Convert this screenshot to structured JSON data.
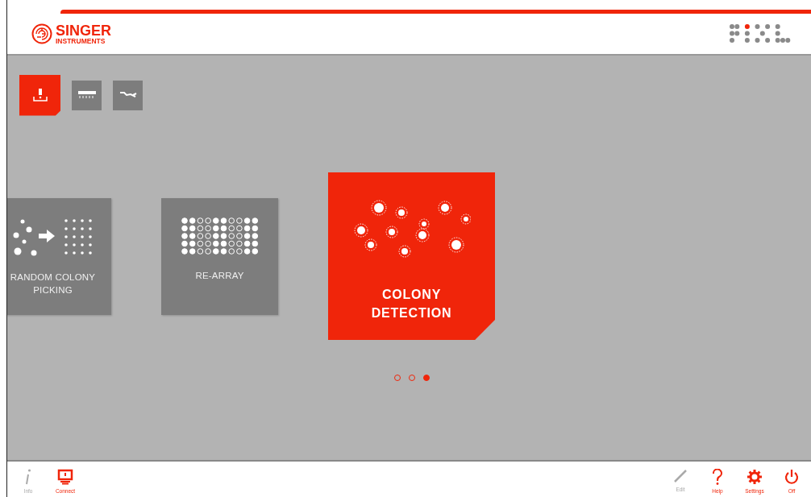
{
  "header": {
    "brand": "SINGER",
    "brand_sub": "INSTRUMENTS"
  },
  "mode_tabs": [
    {
      "kind": "pick",
      "selected": true
    },
    {
      "kind": "plate",
      "selected": false
    },
    {
      "kind": "tools",
      "selected": false
    }
  ],
  "cards": [
    {
      "kind": "random",
      "label": "RANDOM COLONY PICKING",
      "selected": false
    },
    {
      "kind": "rearray",
      "label": "RE-ARRAY",
      "selected": false
    },
    {
      "kind": "detection",
      "label": "COLONY DETECTION",
      "selected": true
    }
  ],
  "pager": [
    {
      "selected": false
    },
    {
      "selected": false
    },
    {
      "selected": true
    }
  ],
  "footer_left": [
    {
      "kind": "info",
      "label": "Info",
      "disabled": true
    },
    {
      "kind": "connect",
      "label": "Connect",
      "disabled": false
    }
  ],
  "footer_right": [
    {
      "kind": "edit",
      "label": "Edit",
      "disabled": true
    },
    {
      "kind": "help",
      "label": "Help",
      "disabled": false
    },
    {
      "kind": "settings",
      "label": "Settings",
      "disabled": false
    },
    {
      "kind": "off",
      "label": "Off",
      "disabled": false
    }
  ]
}
